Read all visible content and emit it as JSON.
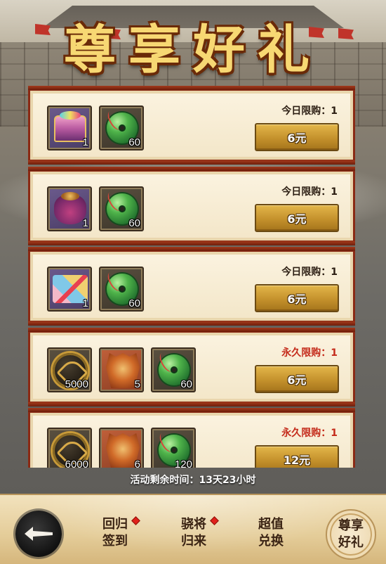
{
  "title": "尊享好礼",
  "gifts": [
    {
      "items": [
        {
          "icon": "treasure-chest-icon",
          "qty": "1"
        },
        {
          "icon": "jade-disc-icon",
          "qty": "60"
        }
      ],
      "limit_text": "今日限购：1",
      "limit_color": "#2b1d12",
      "price": "6元"
    },
    {
      "items": [
        {
          "icon": "treasure-bag-icon",
          "qty": "1"
        },
        {
          "icon": "jade-disc-icon",
          "qty": "60"
        }
      ],
      "limit_text": "今日限购：1",
      "limit_color": "#2b1d12",
      "price": "6元"
    },
    {
      "items": [
        {
          "icon": "gift-pile-icon",
          "qty": "1"
        },
        {
          "icon": "jade-disc-icon",
          "qty": "60"
        }
      ],
      "limit_text": "今日限购：1",
      "limit_color": "#2b1d12",
      "price": "6元"
    },
    {
      "items": [
        {
          "icon": "gold-coin-icon",
          "qty": "5000"
        },
        {
          "icon": "armor-icon",
          "qty": "5"
        },
        {
          "icon": "jade-disc-icon",
          "qty": "60"
        }
      ],
      "limit_text": "永久限购：1",
      "limit_color": "#c42a1a",
      "price": "6元"
    },
    {
      "items": [
        {
          "icon": "gold-coin-icon",
          "qty": "6000"
        },
        {
          "icon": "armor-icon",
          "qty": "6"
        },
        {
          "icon": "jade-disc-icon",
          "qty": "120"
        }
      ],
      "limit_text": "永久限购：1",
      "limit_color": "#c42a1a",
      "price": "12元"
    }
  ],
  "timer": "活动剩余时间：13天23小时",
  "nav": {
    "back_icon": "back-arrow-icon",
    "checkin": [
      "回归",
      "签到"
    ],
    "general": [
      "骁将",
      "归来"
    ],
    "exchange": [
      "超值",
      "兑换"
    ],
    "premium": [
      "尊享",
      "好礼"
    ]
  },
  "colors": {
    "accent_gold": "#c4912c",
    "frame_red": "#8a2a14",
    "title_gold": "#f7d873",
    "notify_red": "#e0201a"
  }
}
